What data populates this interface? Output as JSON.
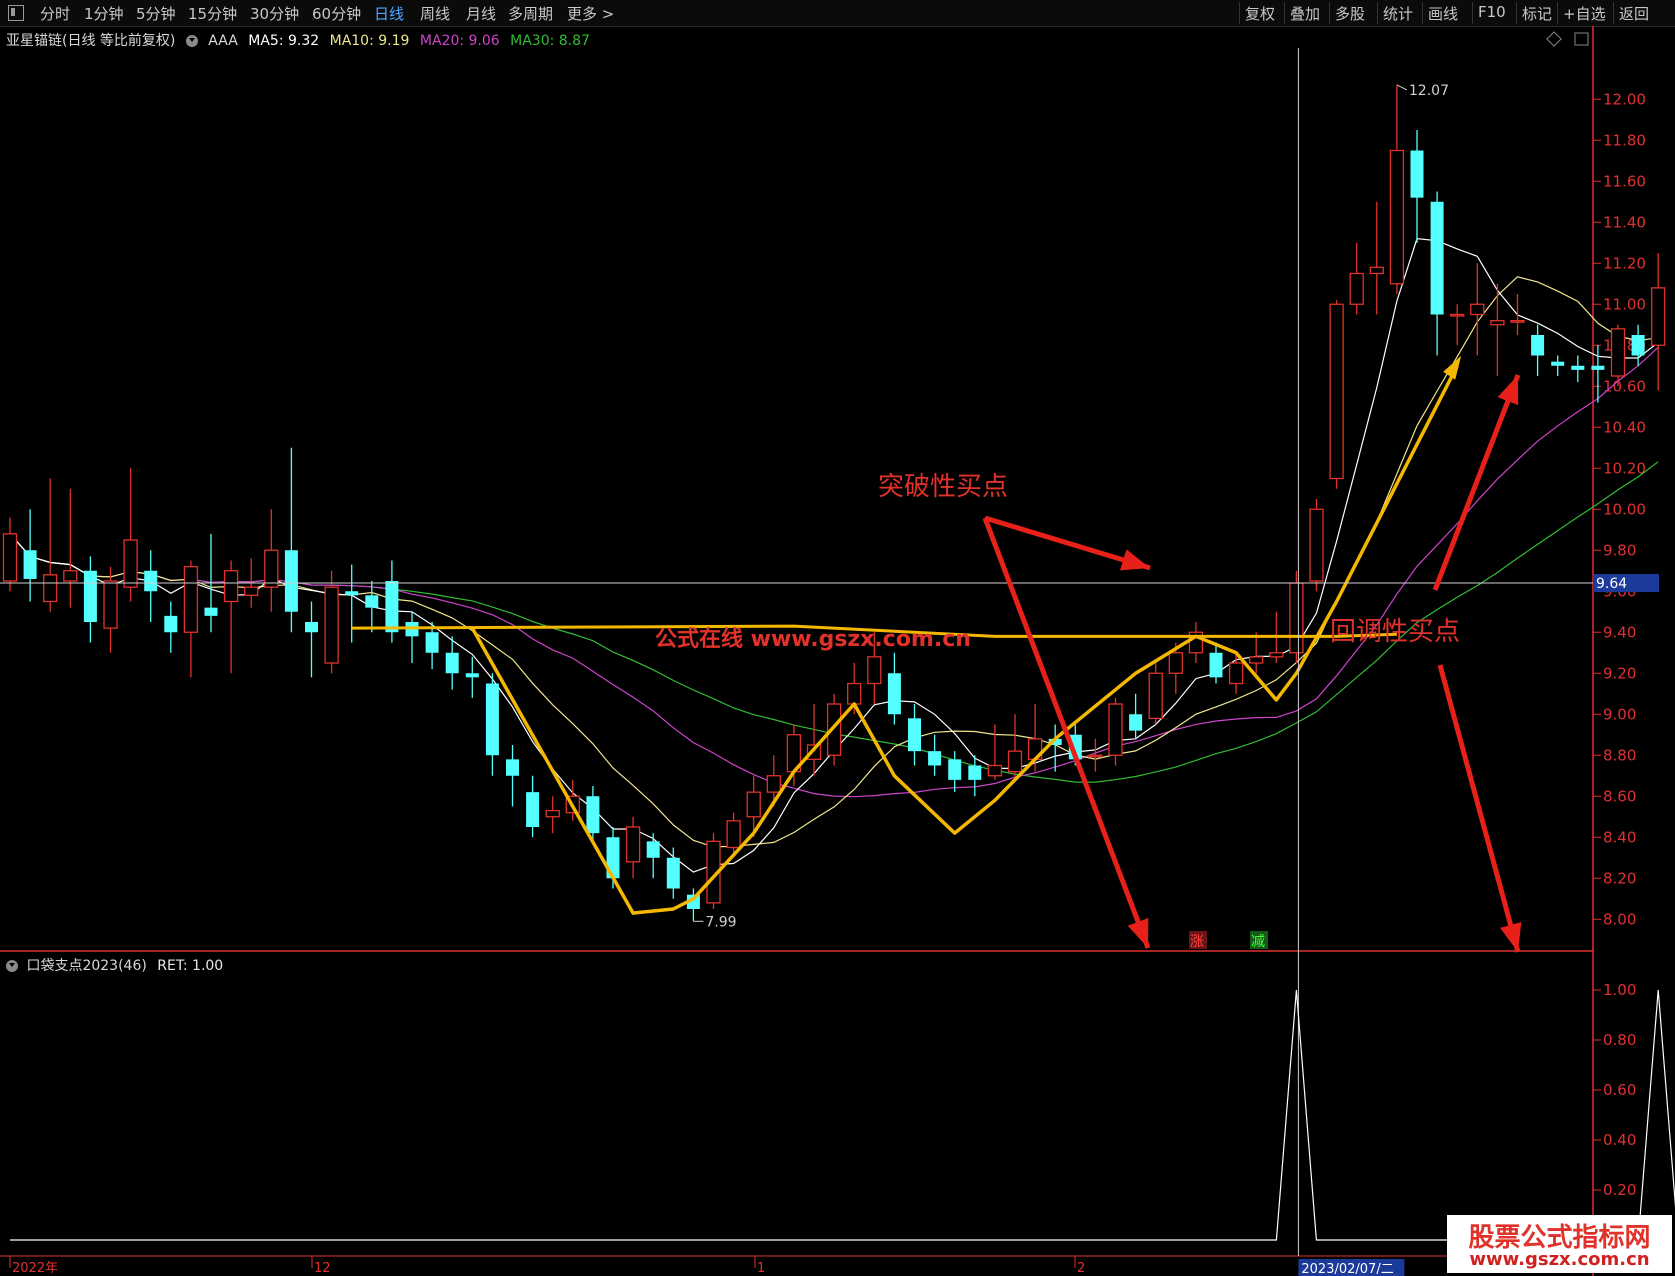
{
  "toolbar": {
    "periods": [
      "分时",
      "1分钟",
      "5分钟",
      "15分钟",
      "30分钟",
      "60分钟",
      "日线",
      "周线",
      "月线",
      "多周期",
      "更多 >"
    ],
    "active_period": "日线",
    "right_items": [
      "复权",
      "叠加",
      "多股",
      "统计",
      "画线",
      "F10",
      "标记",
      "+自选",
      "返回"
    ]
  },
  "info": {
    "stock": "亚星锚链(日线 等比前复权)",
    "indicator": "AAA",
    "ma5": "MA5: 9.32",
    "ma10": "MA10: 9.19",
    "ma20": "MA20: 9.06",
    "ma30": "MA30: 8.87"
  },
  "indicator_panel": {
    "name": "口袋支点2023(46)",
    "ret": "RET: 1.00"
  },
  "annotations": {
    "breakout": "突破性买点",
    "pullback": "回调性买点",
    "watermark": "公式在线 www.gszx.com.cn",
    "high_label": "12.07",
    "low_label": "7.99",
    "crosshair_price": "9.64",
    "crosshair_date": "2023/02/07/二",
    "badge_up": "涨",
    "badge_down": "减"
  },
  "logo": {
    "main": "股票公式指标网",
    "url": "www.gszx.com.cn"
  },
  "colors": {
    "up": "#e0322a",
    "down": "#54ffff",
    "ma5": "#ffffff",
    "ma10": "#f0e68c",
    "ma20": "#cc44cc",
    "ma30": "#33bb33",
    "trend": "#f5b800",
    "axis": "#e03030"
  },
  "chart_data": [
    {
      "type": "candlestick",
      "title": "亚星锚链(日线 等比前复权)",
      "y_ticks": [
        "12.00",
        "11.80",
        "11.60",
        "11.40",
        "11.20",
        "11.00",
        "10.80",
        "10.60",
        "10.40",
        "10.20",
        "10.00",
        "9.80",
        "9.60",
        "9.40",
        "9.20",
        "9.00",
        "8.80",
        "8.60",
        "8.40",
        "8.20",
        "8.00"
      ],
      "x_labels": [
        "2022年",
        "12",
        "1",
        "2"
      ],
      "ylim": [
        7.85,
        12.25
      ],
      "candles": [
        [
          9.65,
          9.88,
          9.96,
          9.6
        ],
        [
          9.8,
          9.66,
          10.0,
          9.55
        ],
        [
          9.55,
          9.68,
          10.15,
          9.5
        ],
        [
          9.65,
          9.7,
          10.1,
          9.52
        ],
        [
          9.7,
          9.45,
          9.77,
          9.35
        ],
        [
          9.42,
          9.65,
          9.72,
          9.3
        ],
        [
          9.62,
          9.85,
          10.2,
          9.55
        ],
        [
          9.7,
          9.6,
          9.8,
          9.45
        ],
        [
          9.48,
          9.4,
          9.55,
          9.3
        ],
        [
          9.4,
          9.72,
          9.75,
          9.18
        ],
        [
          9.52,
          9.48,
          9.88,
          9.4
        ],
        [
          9.55,
          9.7,
          9.75,
          9.2
        ],
        [
          9.58,
          9.62,
          9.76,
          9.52
        ],
        [
          9.62,
          9.8,
          10.0,
          9.5
        ],
        [
          9.8,
          9.5,
          10.3,
          9.4
        ],
        [
          9.45,
          9.4,
          9.55,
          9.18
        ],
        [
          9.25,
          9.62,
          9.7,
          9.2
        ],
        [
          9.6,
          9.58,
          9.73,
          9.35
        ],
        [
          9.58,
          9.52,
          9.65,
          9.4
        ],
        [
          9.65,
          9.4,
          9.75,
          9.35
        ],
        [
          9.45,
          9.38,
          9.5,
          9.25
        ],
        [
          9.4,
          9.3,
          9.45,
          9.22
        ],
        [
          9.3,
          9.2,
          9.38,
          9.12
        ],
        [
          9.2,
          9.18,
          9.28,
          9.08
        ],
        [
          9.15,
          8.8,
          9.2,
          8.7
        ],
        [
          8.78,
          8.7,
          8.85,
          8.55
        ],
        [
          8.62,
          8.45,
          8.7,
          8.4
        ],
        [
          8.5,
          8.53,
          8.6,
          8.42
        ],
        [
          8.52,
          8.6,
          8.68,
          8.48
        ],
        [
          8.6,
          8.42,
          8.65,
          8.38
        ],
        [
          8.4,
          8.2,
          8.45,
          8.15
        ],
        [
          8.28,
          8.45,
          8.5,
          8.2
        ],
        [
          8.38,
          8.3,
          8.42,
          8.2
        ],
        [
          8.3,
          8.15,
          8.35,
          8.1
        ],
        [
          8.12,
          8.05,
          8.15,
          7.99
        ],
        [
          8.08,
          8.38,
          8.42,
          8.05
        ],
        [
          8.35,
          8.48,
          8.52,
          8.3
        ],
        [
          8.5,
          8.62,
          8.7,
          8.4
        ],
        [
          8.62,
          8.7,
          8.8,
          8.55
        ],
        [
          8.72,
          8.9,
          8.95,
          8.65
        ],
        [
          8.78,
          8.85,
          9.05,
          8.7
        ],
        [
          8.8,
          9.05,
          9.1,
          8.75
        ],
        [
          9.05,
          9.15,
          9.25,
          9.0
        ],
        [
          9.15,
          9.28,
          9.4,
          9.05
        ],
        [
          9.2,
          9.0,
          9.3,
          8.95
        ],
        [
          8.98,
          8.82,
          9.05,
          8.75
        ],
        [
          8.82,
          8.75,
          8.9,
          8.7
        ],
        [
          8.78,
          8.68,
          8.82,
          8.62
        ],
        [
          8.75,
          8.68,
          8.8,
          8.6
        ],
        [
          8.7,
          8.75,
          8.95,
          8.68
        ],
        [
          8.72,
          8.82,
          9.0,
          8.68
        ],
        [
          8.78,
          8.88,
          9.05,
          8.72
        ],
        [
          8.88,
          8.85,
          8.95,
          8.72
        ],
        [
          8.9,
          8.78,
          8.95,
          8.75
        ],
        [
          8.8,
          8.8,
          8.88,
          8.72
        ],
        [
          8.8,
          9.05,
          9.08,
          8.75
        ],
        [
          9.0,
          8.92,
          9.1,
          8.88
        ],
        [
          8.98,
          9.2,
          9.25,
          8.95
        ],
        [
          9.2,
          9.3,
          9.35,
          9.1
        ],
        [
          9.3,
          9.4,
          9.45,
          9.25
        ],
        [
          9.3,
          9.18,
          9.35,
          9.15
        ],
        [
          9.15,
          9.25,
          9.3,
          9.1
        ],
        [
          9.25,
          9.28,
          9.4,
          9.2
        ],
        [
          9.28,
          9.3,
          9.5,
          9.25
        ],
        [
          9.3,
          9.64,
          9.7,
          9.25
        ],
        [
          9.65,
          10.0,
          10.05,
          9.6
        ],
        [
          10.15,
          11.0,
          11.02,
          10.1
        ],
        [
          11.0,
          11.15,
          11.3,
          10.95
        ],
        [
          11.15,
          11.18,
          11.5,
          10.95
        ],
        [
          11.1,
          11.75,
          12.07,
          11.05
        ],
        [
          11.75,
          11.52,
          11.85,
          11.3
        ],
        [
          11.5,
          10.95,
          11.55,
          10.75
        ],
        [
          10.95,
          10.95,
          11.0,
          10.8
        ],
        [
          10.95,
          11.0,
          11.2,
          10.75
        ],
        [
          10.9,
          10.92,
          11.1,
          10.65
        ],
        [
          10.92,
          10.92,
          11.05,
          10.85
        ],
        [
          10.85,
          10.75,
          10.9,
          10.65
        ],
        [
          10.72,
          10.7,
          10.75,
          10.65
        ],
        [
          10.7,
          10.68,
          10.75,
          10.62
        ],
        [
          10.7,
          10.68,
          10.8,
          10.52
        ],
        [
          10.65,
          10.88,
          10.9,
          10.6
        ],
        [
          10.85,
          10.75,
          10.9,
          10.7
        ],
        [
          10.8,
          11.08,
          11.25,
          10.58
        ]
      ],
      "ma_series": [
        {
          "name": "MA5",
          "last": 9.32
        },
        {
          "name": "MA10",
          "last": 9.19
        },
        {
          "name": "MA20",
          "last": 9.06
        },
        {
          "name": "MA30",
          "last": 8.87
        }
      ]
    },
    {
      "type": "line",
      "title": "口袋支点2023(46)",
      "y_ticks": [
        "1.00",
        "0.80",
        "0.60",
        "0.40",
        "0.20"
      ],
      "ylim": [
        0,
        1.1
      ],
      "signal_indices": [
        64,
        82
      ],
      "values_note": "RET 0 except signal days where RET=1.00"
    }
  ]
}
